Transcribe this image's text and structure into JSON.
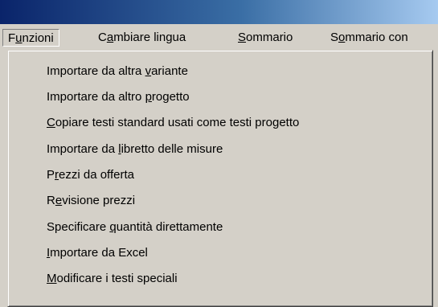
{
  "menubar": {
    "items": [
      {
        "pre": "F",
        "key": "u",
        "post": "nzioni"
      },
      {
        "pre": "C",
        "key": "a",
        "post": "mbiare lingua"
      },
      {
        "pre": "",
        "key": "S",
        "post": "ommario"
      },
      {
        "pre": "S",
        "key": "o",
        "post": "mmario con"
      }
    ]
  },
  "dropdown": {
    "items": [
      {
        "pre": "Importare da altra ",
        "key": "v",
        "post": "ariante"
      },
      {
        "pre": "Importare da altro ",
        "key": "p",
        "post": "rogetto"
      },
      {
        "pre": "",
        "key": "C",
        "post": "opiare testi standard usati come testi progetto"
      },
      {
        "pre": "Importare da ",
        "key": "l",
        "post": "ibretto delle misure"
      },
      {
        "pre": "P",
        "key": "r",
        "post": "ezzi da offerta"
      },
      {
        "pre": "R",
        "key": "e",
        "post": "visione prezzi"
      },
      {
        "pre": "Specificare ",
        "key": "q",
        "post": "uantità direttamente"
      },
      {
        "pre": "",
        "key": "I",
        "post": "mportare da Excel"
      },
      {
        "pre": "",
        "key": "M",
        "post": "odificare i testi speciali"
      }
    ]
  }
}
